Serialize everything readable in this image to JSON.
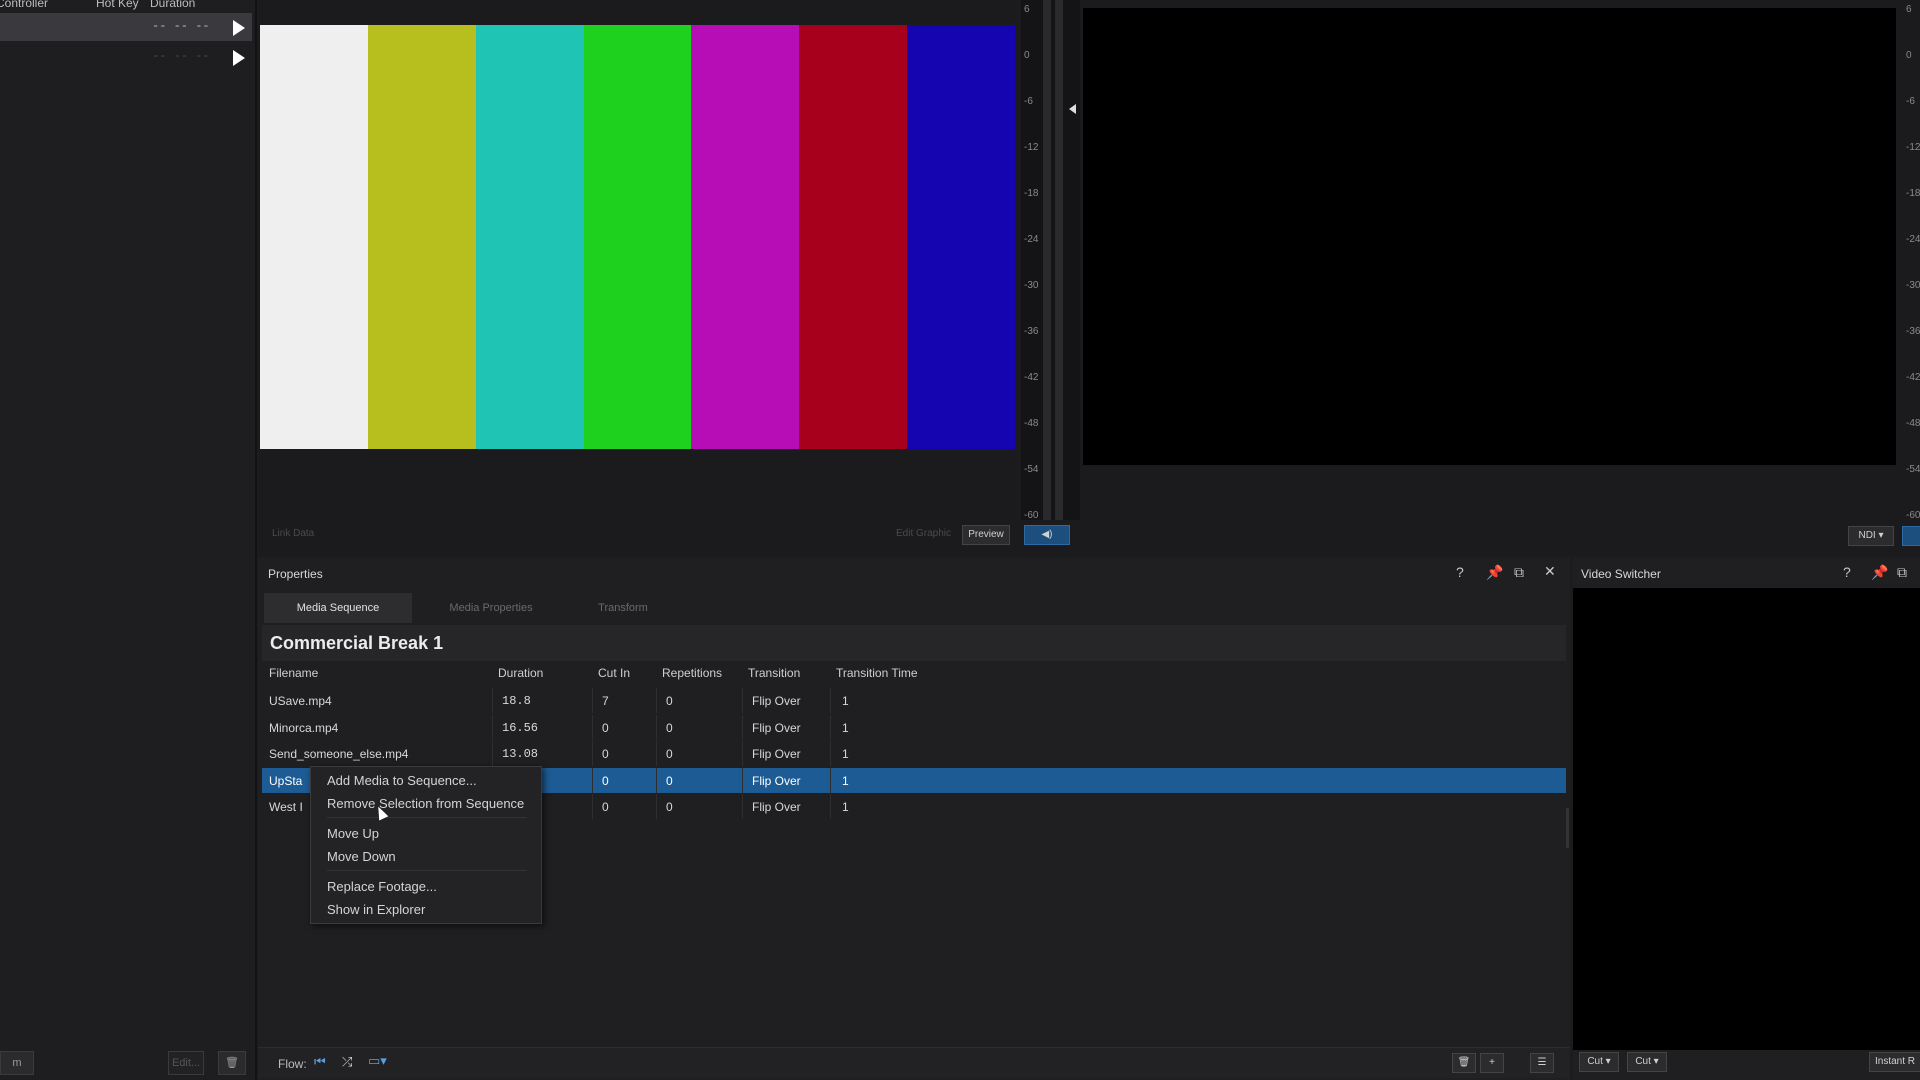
{
  "left": {
    "header_controller": "Controller",
    "header_hotkey": "Hot Key",
    "header_duration": "Duration",
    "rows": [
      {
        "duration": "-- -- --"
      },
      {
        "duration": "-- -- --"
      }
    ],
    "footer_left": "m",
    "footer_mid": "Edit...",
    "trash_icon": "trash-icon"
  },
  "preview": {
    "bars": [
      "#efefef",
      "#b7bf1e",
      "#1fc4b5",
      "#1fd11f",
      "#b60db6",
      "#a6001d",
      "#1505b1"
    ],
    "meter_ticks": [
      "6",
      "0",
      "-6",
      "-12",
      "-18",
      "-24",
      "-30",
      "-36",
      "-42",
      "-48",
      "-54",
      "-60"
    ],
    "link_data": "Link Data",
    "edit_graphic": "Edit Graphic",
    "preview_btn": "Preview"
  },
  "output": {
    "meter_ticks": [
      "6",
      "0",
      "-6",
      "-12",
      "-18",
      "-24",
      "-30",
      "-36",
      "-42",
      "-48",
      "-54",
      "-60"
    ],
    "ndi_btn": "NDI"
  },
  "properties": {
    "title": "Properties",
    "tabs": [
      "Media Sequence",
      "Media Properties",
      "Transform"
    ],
    "sequence_title": "Commercial Break 1",
    "columns": [
      "Filename",
      "Duration",
      "Cut In",
      "Repetitions",
      "Transition",
      "Transition Time"
    ],
    "rows": [
      {
        "filename": "USave.mp4",
        "duration": "18.8",
        "cut_in": "7",
        "repetitions": "0",
        "transition": "Flip Over",
        "time": "1"
      },
      {
        "filename": "Minorca.mp4",
        "duration": "16.56",
        "cut_in": "0",
        "repetitions": "0",
        "transition": "Flip Over",
        "time": "1"
      },
      {
        "filename": "Send_someone_else.mp4",
        "duration": "13.08",
        "cut_in": "0",
        "repetitions": "0",
        "transition": "Flip Over",
        "time": "1"
      },
      {
        "filename": "UpSta",
        "duration": "",
        "cut_in": "0",
        "repetitions": "0",
        "transition": "Flip Over",
        "time": "1"
      },
      {
        "filename": "West I",
        "duration": "",
        "cut_in": "0",
        "repetitions": "0",
        "transition": "Flip Over",
        "time": "1"
      }
    ],
    "context_menu": [
      "Add Media to Sequence...",
      "Remove Selection from Sequence",
      "Move Up",
      "Move Down",
      "Replace Footage...",
      "Show in Explorer"
    ],
    "flow_label": "Flow:"
  },
  "switcher": {
    "title": "Video Switcher",
    "cut1": "Cut",
    "cut2": "Cut",
    "instant": "Instant R"
  }
}
